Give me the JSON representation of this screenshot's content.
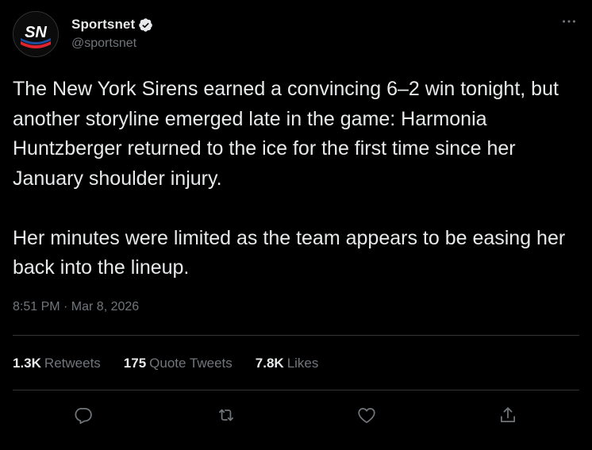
{
  "author": {
    "display_name": "Sportsnet",
    "handle": "@sportsnet",
    "verified": true,
    "avatar_text": "SN"
  },
  "tweet": {
    "paragraphs": [
      "The New York Sirens earned a convincing 6–2 win tonight, but another storyline emerged late in the game: Harmonia Huntzberger returned to the ice for the first time since her January shoulder injury.",
      "Her minutes were limited as the team appears to be easing her back into the lineup."
    ],
    "timestamp": "8:51 PM · Mar 8, 2026"
  },
  "stats": {
    "retweets_count": "1.3K",
    "retweets_label": "Retweets",
    "quotes_count": "175",
    "quotes_label": "Quote Tweets",
    "likes_count": "7.8K",
    "likes_label": "Likes"
  },
  "icons": {
    "more": "more-horizontal-icon",
    "reply": "reply-icon",
    "retweet": "retweet-icon",
    "like": "heart-icon",
    "share": "share-icon",
    "verified": "verified-badge-icon"
  },
  "colors": {
    "background": "#000000",
    "text_primary": "#e7e9ea",
    "text_secondary": "#71767b",
    "divider": "#2f3336",
    "brand_red": "#e0242f",
    "brand_blue": "#1d4f9e"
  }
}
